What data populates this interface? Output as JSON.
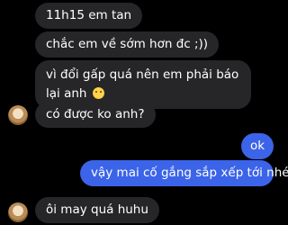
{
  "messages": [
    {
      "text": "11h15 em tan"
    },
    {
      "text": "chắc em về sớm hơn đc ;))"
    },
    {
      "text_line1": "vì đổi gấp quá nên em phải báo",
      "text_line2": "lại anh"
    },
    {
      "text": "có được ko anh?"
    },
    {
      "text": "ok"
    },
    {
      "text": "vậy mai cố gắng sắp xếp tới nhé"
    },
    {
      "text": "ôi may quá huhu"
    }
  ],
  "icons": {
    "emoji": "worried-face-icon",
    "avatar": "user-avatar"
  },
  "colors": {
    "background": "#000000",
    "incoming_bubble": "#262629",
    "outgoing_bubble": "#3b64e8",
    "text": "#ffffff"
  }
}
